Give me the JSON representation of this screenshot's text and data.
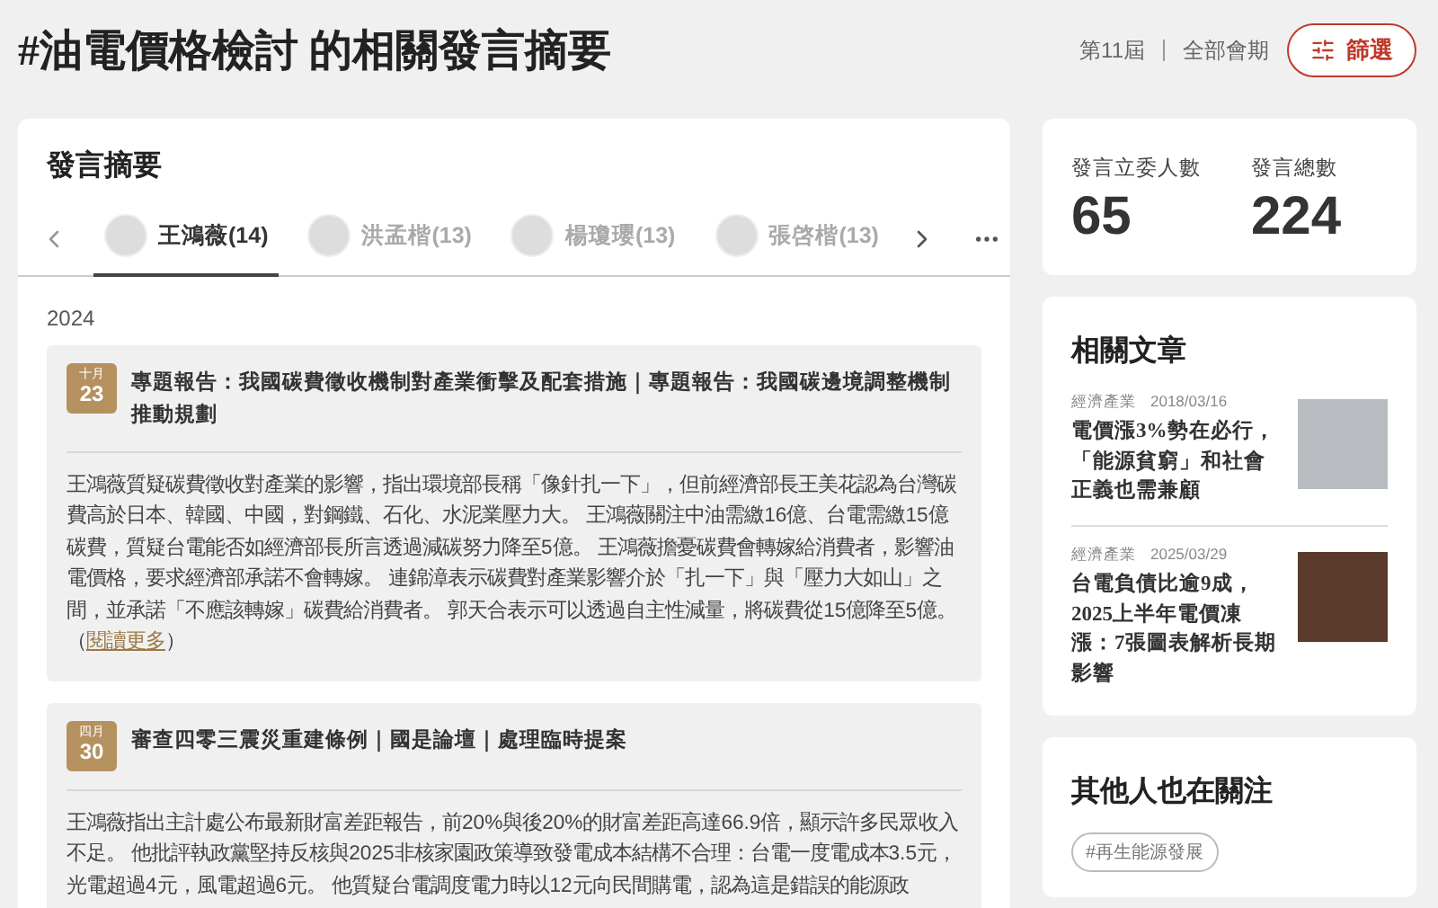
{
  "header": {
    "title": "#油電價格檢討 的相關發言摘要",
    "term": "第11屆",
    "session": "全部會期",
    "filter_button": "篩選"
  },
  "summary": {
    "title": "發言摘要",
    "tabs": [
      {
        "name": "王鴻薇(14)",
        "selected": true
      },
      {
        "name": "洪孟楷(13)",
        "selected": false
      },
      {
        "name": "楊瓊瓔(13)",
        "selected": false
      },
      {
        "name": "張啓楷(13)",
        "selected": false
      }
    ],
    "year": "2024",
    "entries": [
      {
        "month": "十月",
        "day": "23",
        "title": "專題報告：我國碳費徵收機制對產業衝擊及配套措施｜專題報告：我國碳邊境調整機制推動規劃",
        "body": "王鴻薇質疑碳費徵收對產業的影響，指出環境部長稱「像針扎一下」，但前經濟部長王美花認為台灣碳費高於日本、韓國、中國，對鋼鐵、石化、水泥業壓力大。 王鴻薇關注中油需繳16億、台電需繳15億碳費，質疑台電能否如經濟部長所言透過減碳努力降至5億。 王鴻薇擔憂碳費會轉嫁給消費者，影響油電價格，要求經濟部承諾不會轉嫁。 連錦漳表示碳費對產業影響介於「扎一下」與「壓力大如山」之間，並承諾「不應該轉嫁」碳費給消費者。 郭天合表示可以透過自主性減量，將碳費從15億降至5億。",
        "read_more": {
          "open": "（",
          "label": "閱讀更多",
          "close": "）"
        }
      },
      {
        "month": "四月",
        "day": "30",
        "title": "審查四零三震災重建條例｜國是論壇｜處理臨時提案",
        "body": "王鴻薇指出主計處公布最新財富差距報告，前20%與後20%的財富差距高達66.9倍，顯示許多民眾收入不足。 他批評執政黨堅持反核與2025非核家園政策導致發電成本結構不合理：台電一度電成本3.5元，光電超過4元，風電超過6元。 他質疑台電調度電力時以12元向民間購電，認為這是錯誤的能源政"
      }
    ]
  },
  "stats": [
    {
      "label": "發言立委人數",
      "value": "65"
    },
    {
      "label": "發言總數",
      "value": "224"
    }
  ],
  "related": {
    "title": "相關文章",
    "articles": [
      {
        "category": "經濟產業",
        "date": "2018/03/16",
        "title": "電價漲3%勢在必行，「能源貧窮」和社會正義也需兼顧"
      },
      {
        "category": "經濟產業",
        "date": "2025/03/29",
        "title": "台電負債比逾9成，2025上半年電價凍漲：7張圖表解析長期影響"
      }
    ]
  },
  "following": {
    "title": "其他人也在關注",
    "tags": [
      "#再生能源發展"
    ]
  }
}
